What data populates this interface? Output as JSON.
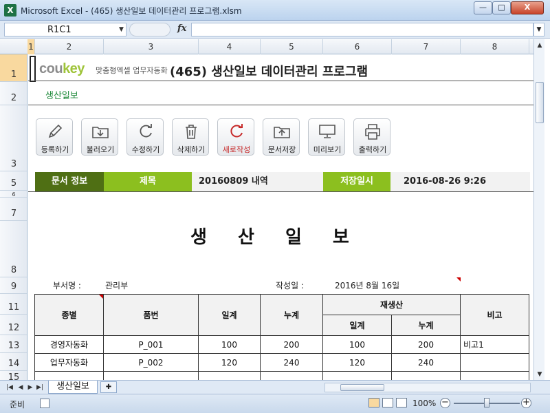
{
  "window": {
    "title": "Microsoft Excel - (465) 생산일보 데이터관리 프로그램.xlsm",
    "app_icon": "X",
    "min": "—",
    "max": "□",
    "close": "X"
  },
  "formula_bar": {
    "name_box": "R1C1",
    "fx": "fx",
    "formula": ""
  },
  "columns": [
    "1",
    "2",
    "3",
    "4",
    "5",
    "6",
    "7",
    "8"
  ],
  "rows": [
    "1",
    "2",
    "3",
    "5",
    "6",
    "7",
    "8",
    "9",
    "11",
    "12",
    "13",
    "14",
    "15"
  ],
  "header": {
    "logo_main": "cou",
    "logo_accent": "key",
    "logo_sub": "맞춤형엑셀 업무자동화",
    "title": "(465) 생산일보 데이터관리 프로그램",
    "subtitle": "생산일보"
  },
  "toolbar": [
    {
      "label": "등록하기",
      "icon": "pencil-icon"
    },
    {
      "label": "불러오기",
      "icon": "folder-download-icon"
    },
    {
      "label": "수정하기",
      "icon": "refresh-icon"
    },
    {
      "label": "삭제하기",
      "icon": "trash-icon"
    },
    {
      "label": "새로작성",
      "icon": "new-refresh-icon"
    },
    {
      "label": "문서저장",
      "icon": "folder-upload-icon"
    },
    {
      "label": "미리보기",
      "icon": "monitor-icon"
    },
    {
      "label": "출력하기",
      "icon": "printer-icon"
    }
  ],
  "info": {
    "doc_label": "문서 정보",
    "title_label": "제목",
    "title_value": "20160809 내역",
    "date_label": "저장일시",
    "date_value": "2016-08-26 9:26"
  },
  "document": {
    "title": "생 산 일 보",
    "dept_label": "부서명 :",
    "dept_value": "관리부",
    "date_label": "작성일 :",
    "date_value": "2016년 8월 16일"
  },
  "table": {
    "headers": {
      "type": "종별",
      "part_no": "품번",
      "daily": "일계",
      "cumulative": "누계",
      "reproduction": "재생산",
      "re_daily": "일계",
      "re_cumulative": "누계",
      "note": "비고"
    },
    "rows": [
      {
        "type": "경영자동화",
        "part_no": "P_001",
        "daily": "100",
        "cumulative": "200",
        "re_daily": "100",
        "re_cumulative": "200",
        "note": "비고1"
      },
      {
        "type": "업무자동화",
        "part_no": "P_002",
        "daily": "120",
        "cumulative": "240",
        "re_daily": "120",
        "re_cumulative": "240",
        "note": ""
      }
    ]
  },
  "sheet_tab": "생산일보",
  "status": {
    "ready": "준비",
    "zoom": "100%",
    "zoom_fraction": 0.5
  }
}
